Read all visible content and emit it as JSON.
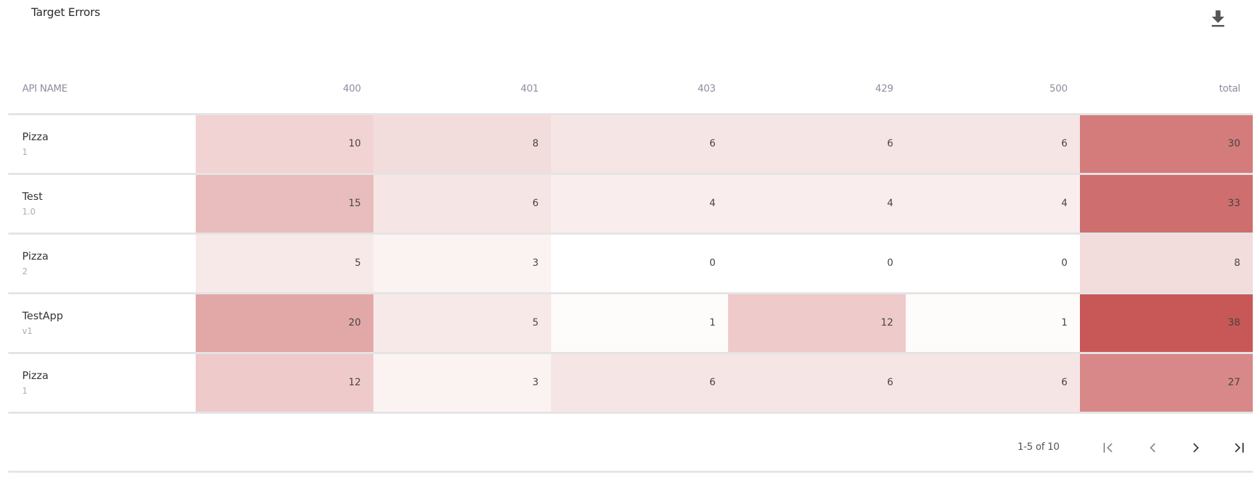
{
  "title": "Target Errors",
  "toolbar": {
    "download_icon": "download-icon"
  },
  "columns": [
    "API NAME",
    "400",
    "401",
    "403",
    "429",
    "500",
    "total"
  ],
  "rows": [
    {
      "name": "Pizza",
      "version": "1",
      "values": [
        10,
        8,
        6,
        6,
        6,
        30
      ]
    },
    {
      "name": "Test",
      "version": "1.0",
      "values": [
        15,
        6,
        4,
        4,
        4,
        33
      ]
    },
    {
      "name": "Pizza",
      "version": "2",
      "values": [
        5,
        3,
        0,
        0,
        0,
        8
      ]
    },
    {
      "name": "TestApp",
      "version": "v1",
      "values": [
        20,
        5,
        1,
        12,
        1,
        38
      ]
    },
    {
      "name": "Pizza",
      "version": "1",
      "values": [
        12,
        3,
        6,
        6,
        6,
        27
      ]
    }
  ],
  "heat_colors": {
    "low": "#ffffff",
    "high": "#c85858"
  },
  "pagination": {
    "range_label": "1-5 of 10",
    "first_icon": "first-page-icon",
    "prev_icon": "previous-page-icon",
    "next_icon": "next-page-icon",
    "last_icon": "last-page-icon"
  }
}
